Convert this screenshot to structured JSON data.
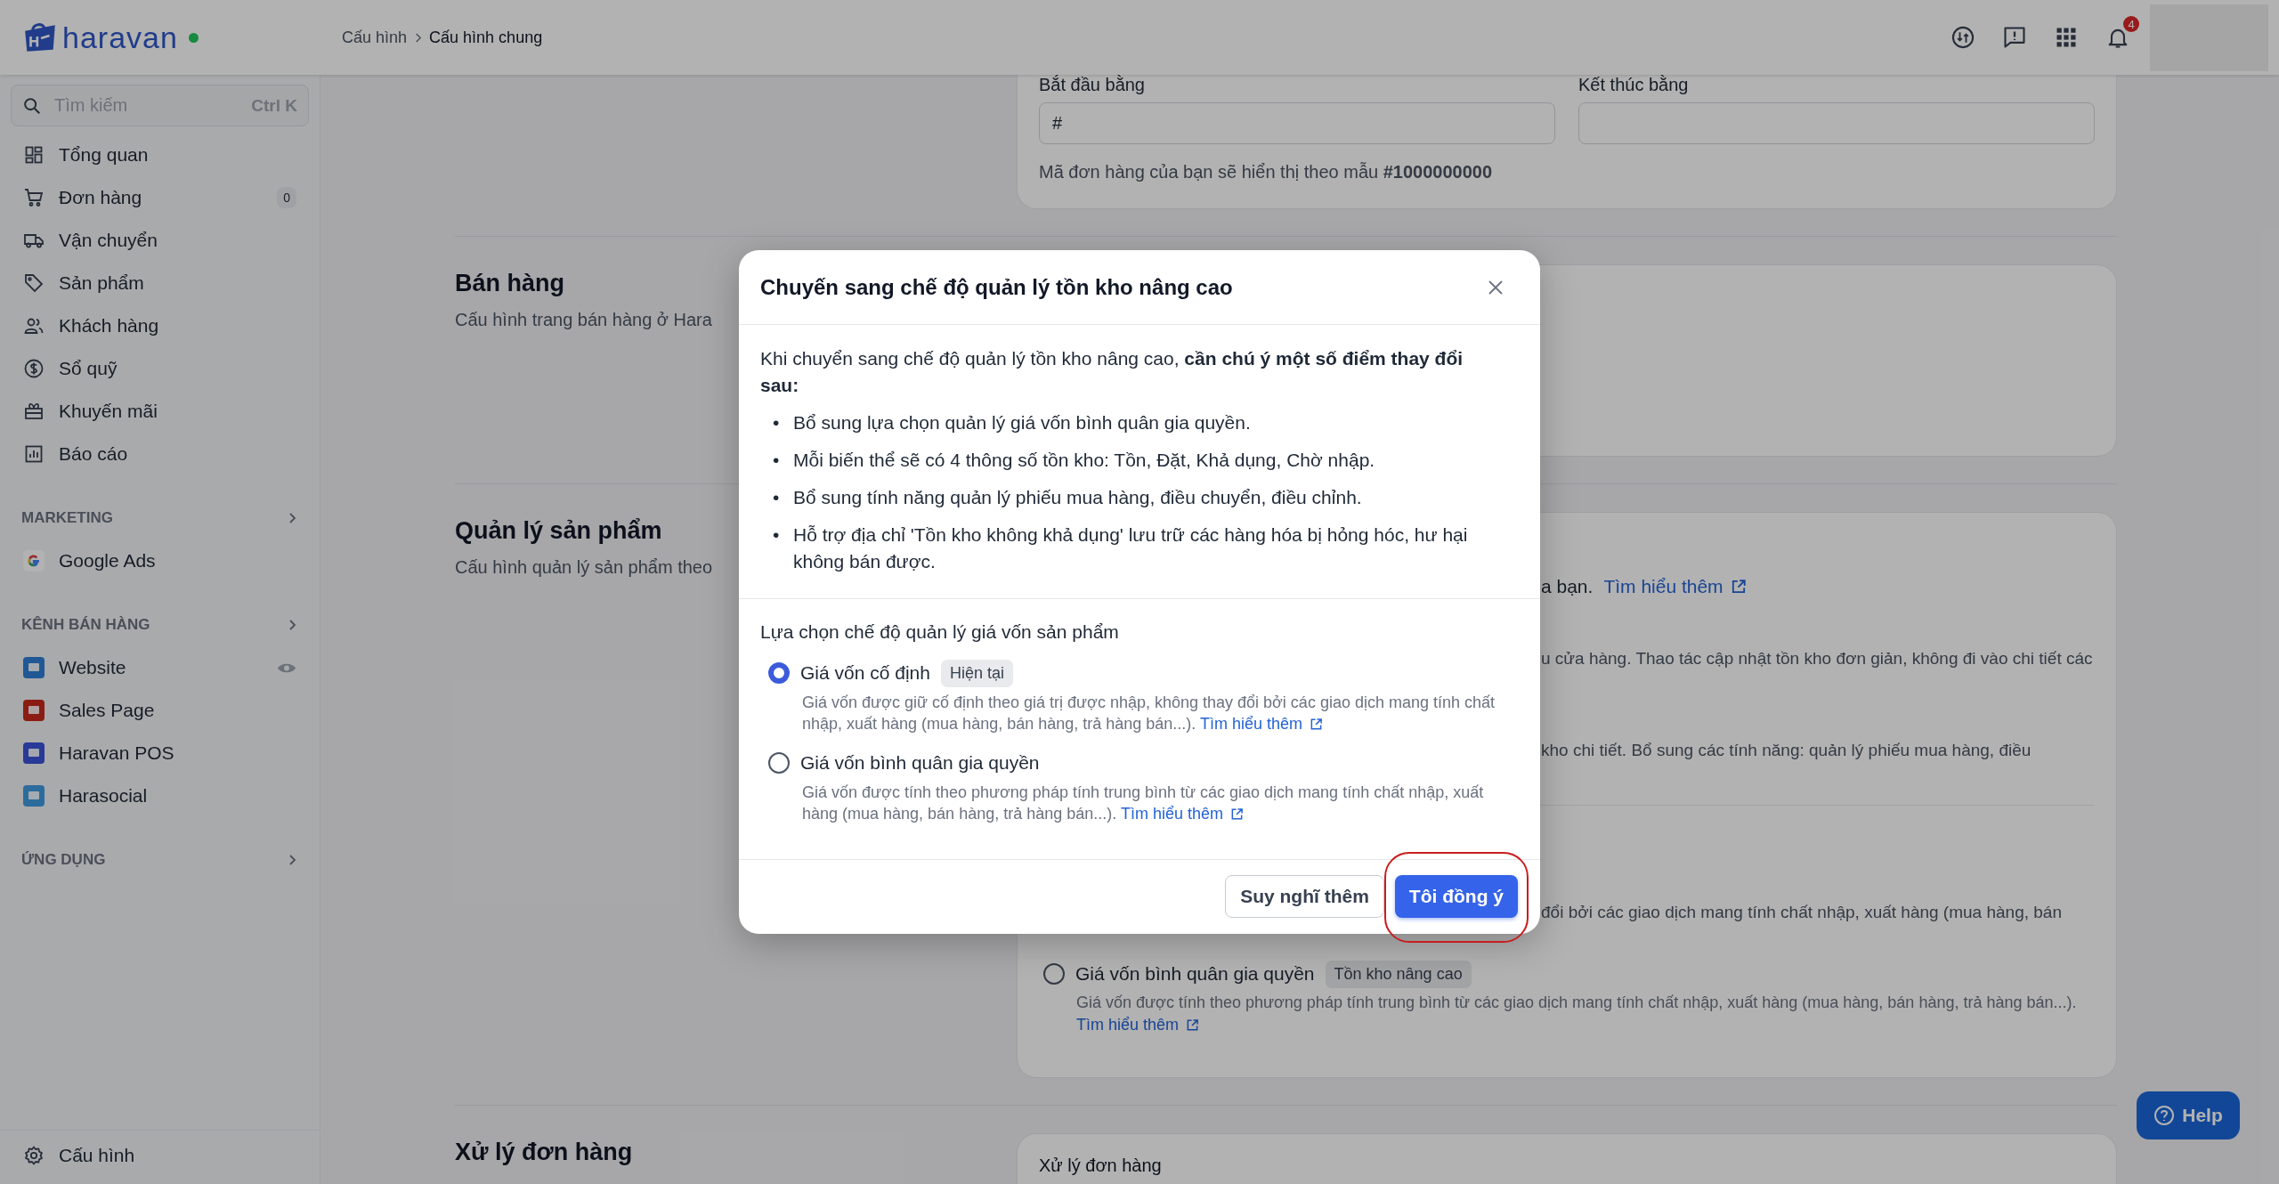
{
  "header": {
    "logo": "haravan",
    "breadcrumb": [
      {
        "label": "Cấu hình"
      },
      {
        "label": "Cấu hình chung"
      }
    ],
    "notification_count": "4"
  },
  "sidebar": {
    "search": {
      "placeholder": "Tìm kiếm",
      "shortcut": "Ctrl K"
    },
    "items": [
      {
        "label": "Tổng quan",
        "kind": "dashboard"
      },
      {
        "label": "Đơn hàng",
        "kind": "cart",
        "badge": "0"
      },
      {
        "label": "Vận chuyển",
        "kind": "truck"
      },
      {
        "label": "Sản phẩm",
        "kind": "tag"
      },
      {
        "label": "Khách hàng",
        "kind": "users"
      },
      {
        "label": "Sổ quỹ",
        "kind": "dollar"
      },
      {
        "label": "Khuyến mãi",
        "kind": "gift"
      },
      {
        "label": "Báo cáo",
        "kind": "chart"
      }
    ],
    "sections": [
      {
        "title": "MARKETING",
        "items": [
          {
            "label": "Google Ads",
            "kind": "google"
          }
        ]
      },
      {
        "title": "KÊNH BÁN HÀNG",
        "items": [
          {
            "label": "Website",
            "kind": "website",
            "show_eye": true
          },
          {
            "label": "Sales Page",
            "kind": "sales_page"
          },
          {
            "label": "Haravan POS",
            "kind": "pos"
          },
          {
            "label": "Harasocial",
            "kind": "social"
          }
        ]
      },
      {
        "title": "ỨNG DỤNG"
      }
    ],
    "footer": {
      "label": "Cấu hình"
    }
  },
  "page": {
    "top_card": {
      "fields": [
        {
          "label": "Bắt đầu bằng",
          "value": "#"
        },
        {
          "label": "Kết thúc bằng"
        }
      ],
      "hint": "Mã đơn hàng của bạn sẽ hiển thị theo mẫu **#1000000000**"
    },
    "sections": [
      {
        "kind": "empty",
        "title": "Bán hàng",
        "description": "Cấu hình trang bán hàng ở Hara"
      },
      {
        "kind": "inventory",
        "title": "Quản lý sản phẩm",
        "description": "Cấu hình quản lý sản phẩm theo",
        "lead": {
          "text": "a bạn.",
          "link": "Tìm hiểu thêm"
        },
        "lines": [
          "u cửa hàng. Thao tác cập nhật tồn kho đơn giản, không đi vào chi tiết các",
          "kho chi tiết. Bổ sung các tính năng: quản lý phiếu mua hàng, điều"
        ],
        "lower_line": "đổi bởi các giao dịch mang tính chất nhập, xuất hàng (mua hàng, bán",
        "option": {
          "label": "Giá vốn bình quân gia quyền",
          "tag": "Tồn kho nâng cao",
          "description": "Giá vốn được tính theo phương pháp tính trung bình từ các giao dịch mang tính chất nhập, xuất hàng (mua hàng, bán hàng, trả hàng bán...).",
          "link": "Tìm hiểu thêm",
          "selected": false
        }
      },
      {
        "kind": "titled",
        "title": "Xử lý đơn hàng",
        "card_title": "Xử lý đơn hàng"
      }
    ]
  },
  "help_button": {
    "label": "Help"
  },
  "modal": {
    "title": "Chuyến sang chế độ quản lý tồn kho nâng cao",
    "intro": "Khi chuyển sang chế độ quản lý tồn kho nâng cao, **cần chú ý một số điểm thay đổi sau:**",
    "bullet": "•",
    "points": [
      "Bổ sung lựa chọn quản lý giá vốn bình quân gia quyền.",
      "Mỗi biến thể sẽ có 4 thông số tồn kho: Tồn, Đặt, Khả dụng, Chờ nhập.",
      "Bổ sung tính năng quản lý phiếu mua hàng, điều chuyển, điều chỉnh.",
      "Hỗ trợ địa chỉ 'Tồn kho không khả dụng' lưu trữ các hàng hóa bị hỏng hóc, hư hại không bán được."
    ],
    "options_title": "Lựa chọn chế độ quản lý giá vốn sản phẩm",
    "options": [
      {
        "label": "Giá vốn cố định",
        "tag": "Hiện tại",
        "description": "Giá vốn được giữ cố định theo giá trị được nhập, không thay đổi bởi các giao dịch mang tính chất nhập, xuất hàng (mua hàng, bán hàng, trả hàng bán...).",
        "link": "Tìm hiểu thêm",
        "selected": true
      },
      {
        "label": "Giá vốn bình quân gia quyền",
        "description": "Giá vốn được tính theo phương pháp tính trung bình từ các giao dịch mang tính chất nhập, xuất hàng (mua hàng, bán hàng, trả hàng bán...).",
        "link": "Tìm hiểu thêm",
        "selected": false
      }
    ],
    "buttons": [
      {
        "label": "Suy nghĩ thêm",
        "kind": "secondary",
        "highlighted": false
      },
      {
        "label": "Tôi đồng ý",
        "kind": "primary",
        "highlighted": true
      }
    ]
  }
}
